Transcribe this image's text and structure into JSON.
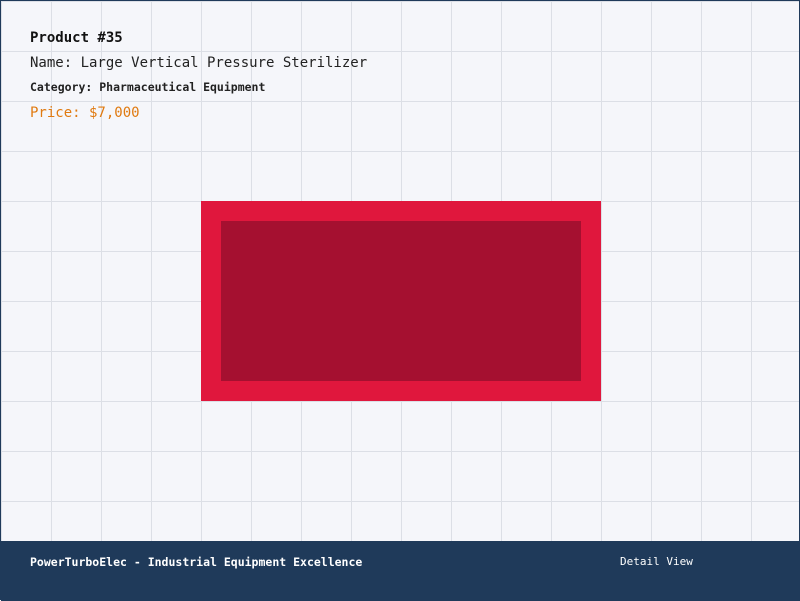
{
  "product": {
    "number_label": "Product #35",
    "name_label": "Name: Large Vertical Pressure Sterilizer",
    "category_label": "Category: Pharmaceutical Equipment",
    "price_label": "Price: $7,000",
    "image": {
      "outer_color": "#e0173d",
      "inner_color": "#a51030"
    }
  },
  "footer": {
    "brand_text": "PowerTurboElec - Industrial Equipment Excellence",
    "view_label": "Detail View"
  },
  "colors": {
    "background": "#f5f6fa",
    "grid_line": "#dcdfe6",
    "footer_bg": "#1f3a5a",
    "price_accent": "#e07a10"
  }
}
